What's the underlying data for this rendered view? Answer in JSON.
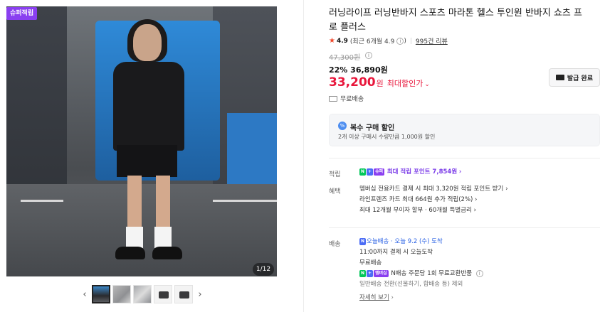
{
  "left": {
    "badge": "슈퍼적립",
    "counter": "1/12",
    "thumb_prev": "‹",
    "thumb_next": "›"
  },
  "product": {
    "title": "러닝라이프 러닝반바지 스포츠 마라톤 헬스 투인원 반바지 쇼츠 프로 플러스",
    "rating": "4.9",
    "rating_recent": "(최근 6개월 4.9",
    "review_count": "995건 리뷰",
    "original_price": "47,300원",
    "discount_line": "22% 36,890원",
    "final_price": "33,200",
    "final_unit": "원",
    "final_label": "최대할인가",
    "coupon_button": "발급 완료",
    "shipping_free": "무료배송"
  },
  "bulk_discount": {
    "title": "복수 구매 할인",
    "desc": "2개 이상 구매시 수량만큼 1,000원 할인"
  },
  "points": {
    "label": "적립",
    "text": "최대 적립 포인트 7,854원"
  },
  "benefits": {
    "label": "혜택",
    "lines": [
      "멤버십 전용카드 결제 시 최대 3,320원 적립 포인트 받기",
      "라인프렌즈 카드 최대 664원 추가 적립(2%)",
      "최대 12개월 무이자 할부 · 60개월 특별금리"
    ]
  },
  "delivery": {
    "label": "배송",
    "today_brand": "오늘배송",
    "today_date": "· 오늘 9.2 (수) 도착",
    "cutoff": "11:00까지 결제 시 오늘도착",
    "free": "무료배송",
    "exchange": "N배송 주문당 1회 무료교환반품",
    "exclude": "일반배송 전환(선물하기, 합배송 등) 제외",
    "details_link": "자세히 보기"
  },
  "colors": {
    "accent_red": "#e8163b",
    "accent_purple": "#8a3ff0",
    "naver_green": "#03c75a"
  }
}
